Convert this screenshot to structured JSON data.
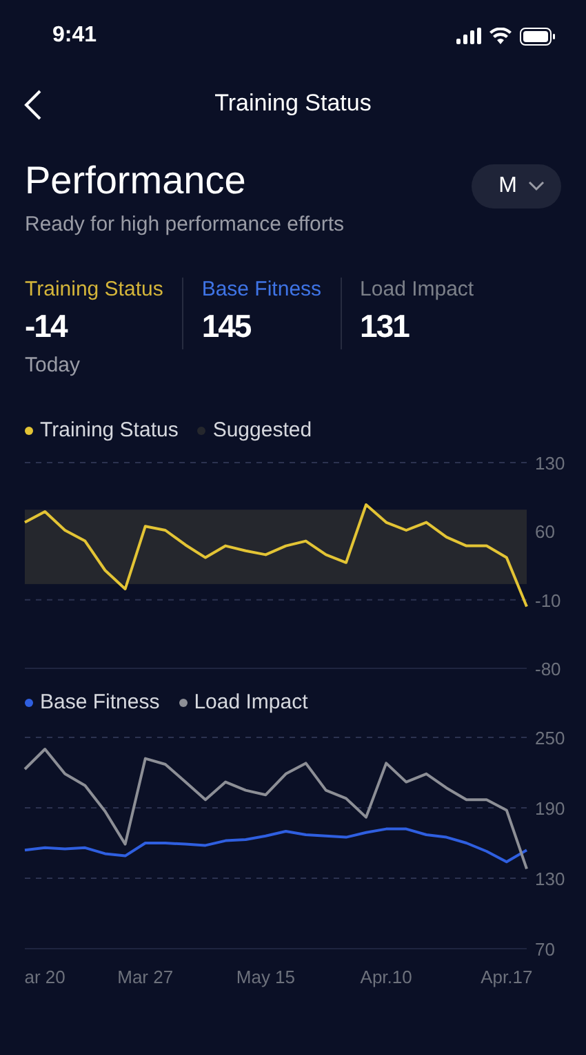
{
  "status_bar": {
    "time": "9:41"
  },
  "nav": {
    "title": "Training Status"
  },
  "header": {
    "title": "Performance",
    "subtitle": "Ready for high performance efforts",
    "period": "M"
  },
  "stats": [
    {
      "label": "Training Status",
      "value": "-14",
      "color": "#d4b53a",
      "note": "Today"
    },
    {
      "label": "Base Fitness",
      "value": "145",
      "color": "#3f74e6"
    },
    {
      "label": "Load Impact",
      "value": "131",
      "color": "#7c8089"
    }
  ],
  "charts": [
    {
      "chart_data": {
        "type": "line",
        "ylim": [
          -80,
          130
        ],
        "yticks": [
          130,
          60,
          -10,
          -80
        ],
        "series": [
          {
            "name": "Training Status",
            "color": "#e3c435",
            "values": [
              69,
              80,
              61,
              50,
              20,
              1,
              65,
              61,
              46,
              33,
              45,
              40,
              36,
              45,
              50,
              36,
              28,
              87,
              69,
              61,
              69,
              54,
              45,
              45,
              33,
              -17
            ]
          }
        ],
        "bands": [
          {
            "label": "Suggested",
            "axis": "y",
            "from": 6,
            "to": 82,
            "color": "#25272d"
          }
        ]
      }
    },
    {
      "chart_data": {
        "type": "line",
        "categories": [
          null,
          "ar 20",
          null,
          null,
          null,
          null,
          "Mar 27",
          null,
          null,
          null,
          null,
          null,
          "May 15",
          null,
          null,
          null,
          null,
          null,
          "Apr.10",
          null,
          null,
          null,
          null,
          null,
          "Apr.17",
          null
        ],
        "ylim": [
          70,
          250
        ],
        "yticks": [
          250,
          190,
          130,
          70
        ],
        "series": [
          {
            "name": "Base Fitness",
            "color": "#2f5fe0",
            "values": [
              154,
              156,
              155,
              156,
              151,
              149,
              160,
              160,
              159,
              158,
              162,
              163,
              166,
              170,
              167,
              166,
              165,
              169,
              172,
              172,
              167,
              165,
              160,
              153,
              144,
              154
            ]
          },
          {
            "name": "Load Impact",
            "color": "#8d8f96",
            "values": [
              223,
              240,
              219,
              209,
              187,
              159,
              232,
              227,
              212,
              197,
              212,
              205,
              201,
              219,
              228,
              205,
              198,
              182,
              228,
              212,
              219,
              207,
              197,
              197,
              188,
              138
            ]
          }
        ]
      }
    }
  ]
}
